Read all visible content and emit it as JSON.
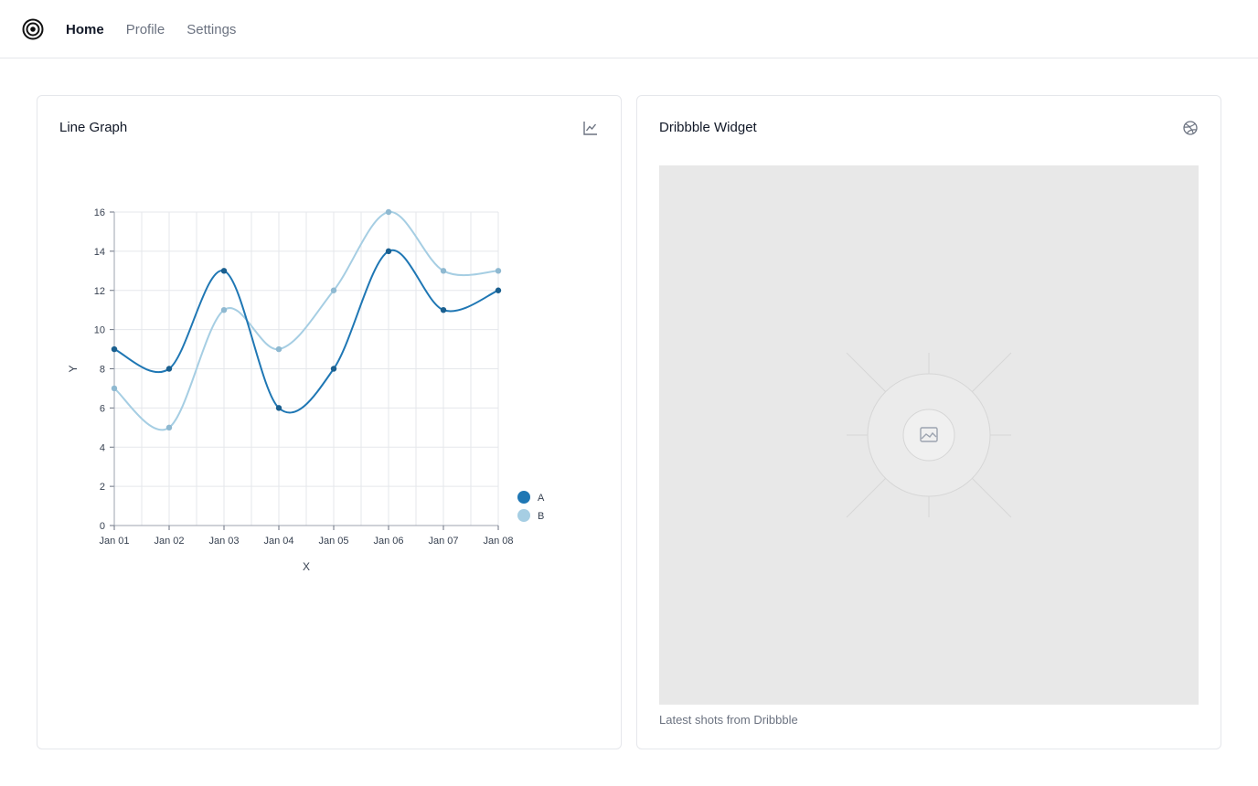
{
  "nav": {
    "items": [
      {
        "label": "Home",
        "active": true
      },
      {
        "label": "Profile",
        "active": false
      },
      {
        "label": "Settings",
        "active": false
      }
    ]
  },
  "line_card": {
    "title": "Line Graph",
    "icon": "line-chart-icon"
  },
  "dribbble_card": {
    "title": "Dribbble Widget",
    "icon": "dribbble-icon",
    "image_icon": "image-icon",
    "caption": "Latest shots from Dribbble"
  },
  "colors": {
    "series_a": "#1f77b4",
    "series_b": "#a6cee3",
    "grid": "#e5e7eb",
    "placeholder": "#e8e8e8"
  },
  "chart_data": {
    "type": "line",
    "xlabel": "X",
    "ylabel": "Y",
    "categories": [
      "Jan 01",
      "Jan 02",
      "Jan 03",
      "Jan 04",
      "Jan 05",
      "Jan 06",
      "Jan 07",
      "Jan 08"
    ],
    "ylim": [
      0,
      16
    ],
    "yticks": [
      0,
      2,
      4,
      6,
      8,
      10,
      12,
      14,
      16
    ],
    "grid": true,
    "legend_position": "right",
    "series": [
      {
        "name": "A",
        "values": [
          9,
          8,
          13,
          6,
          8,
          14,
          11,
          12
        ]
      },
      {
        "name": "B",
        "values": [
          7,
          5,
          11,
          9,
          12,
          16,
          13,
          13
        ]
      }
    ]
  }
}
